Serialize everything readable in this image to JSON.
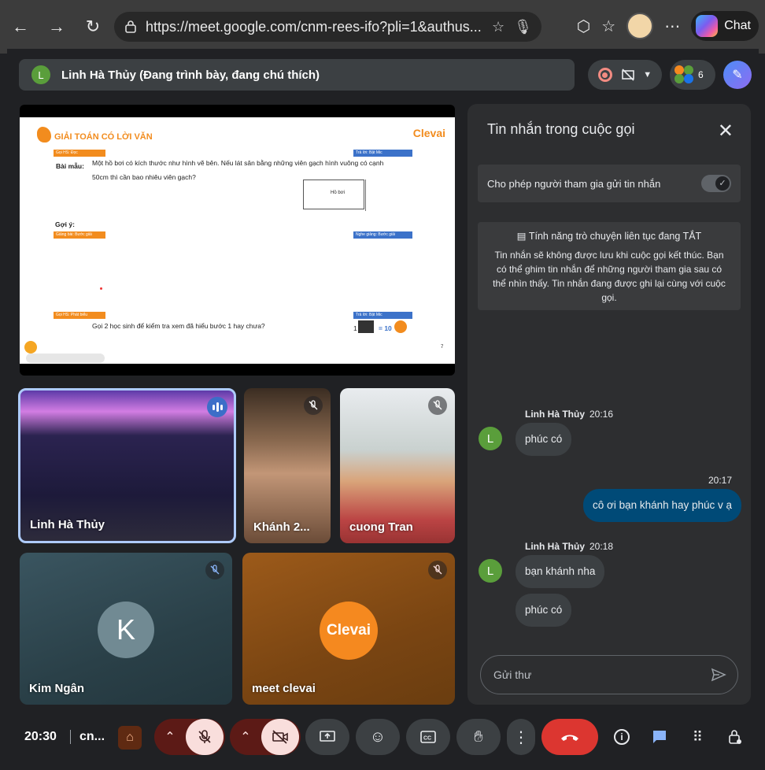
{
  "browser": {
    "url": "https://meet.google.com/cnm-rees-ifo?pli=1&authus...",
    "chat_label": "Chat"
  },
  "presenter": {
    "initial": "L",
    "label": "Linh Hà Thủy (Đang trình bày, đang chú thích)"
  },
  "participants_count": "6",
  "slide": {
    "title": "GIẢI TOÁN CÓ LỜI VĂN",
    "brand": "Clevai",
    "tag1": "Gọi HS: Đọc",
    "tag2": "Trả lời: Bật Mic",
    "problem_label": "Bài mẫu:",
    "problem_line1": "Một hồ bơi có kích thước như hình vẽ bên. Nếu lát sân bằng những viên gạch hình vuông có cạnh",
    "problem_line2": "50cm thì cần bao nhiêu viên gạch?",
    "pool_label": "Hồ bơi",
    "hint_label": "Gợi ý:",
    "tag3": "Giảng bài: Bước giải",
    "tag4": "Nghe giảng: Bước giải",
    "tag5": "Gọi HS: Phát biểu",
    "tag6": "Trả lời: Bật Mic",
    "question": "Gọi 2 học sinh để kiểm tra xem đã hiểu bước 1 hay chưa?",
    "reward_count": "1",
    "reward_value": "= 10",
    "page_number": "7"
  },
  "tiles": [
    {
      "name": "Linh Hà Thủy"
    },
    {
      "name": "Khánh 2..."
    },
    {
      "name": "cuong Tran"
    },
    {
      "name": "Kim Ngân",
      "initial": "K"
    },
    {
      "name": "meet clevai",
      "logo": "Clevai"
    }
  ],
  "chat": {
    "title": "Tin nhắn trong cuộc gọi",
    "allow_label": "Cho phép người tham gia gửi tin nhắn",
    "continuous_heading": "Tính năng trò chuyện liên tục đang TẮT",
    "continuous_body": "Tin nhắn sẽ không được lưu khi cuộc gọi kết thúc. Bạn có thể ghim tin nhắn để những người tham gia sau có thể nhìn thấy. Tin nhắn đang được ghi lại cùng với cuộc gọi.",
    "messages": [
      {
        "sender": "Linh Hà Thủy",
        "time": "20:16",
        "initial": "L",
        "texts": [
          "phúc có"
        ]
      },
      {
        "sender": "me",
        "time": "20:17",
        "texts": [
          "cô ơi bạn khánh hay phúc v ạ"
        ]
      },
      {
        "sender": "Linh Hà Thủy",
        "time": "20:18",
        "initial": "L",
        "texts": [
          "bạn khánh nha",
          "phúc có"
        ]
      }
    ],
    "send_placeholder": "Gửi thư"
  },
  "bottom": {
    "clock": "20:30",
    "meeting_code": "cn..."
  },
  "colors": {
    "end_call": "#dc3630",
    "mic_off_bg": "#f9dedc",
    "my_bubble": "#004a77"
  }
}
